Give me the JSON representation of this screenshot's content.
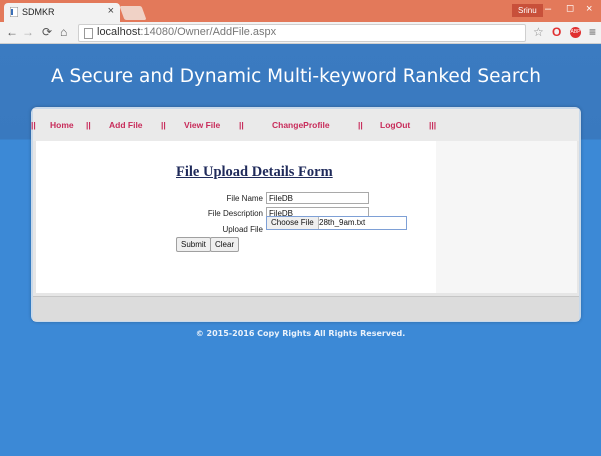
{
  "browser": {
    "tab_title": "SDMKR",
    "tab_close": "×",
    "user_badge": "Srinu",
    "window_min": "–",
    "window_max": "◻",
    "window_close": "×",
    "url_host": "localhost",
    "url_rest": ":14080/Owner/AddFile.aspx",
    "icons": {
      "back": "back-arrow-icon",
      "forward": "forward-arrow-icon",
      "reload": "reload-icon",
      "home": "home-icon",
      "bookmark": "star-icon",
      "opera": "opera-icon",
      "adblock": "adblock-icon",
      "menu": "menu-icon"
    }
  },
  "site": {
    "title": "A Secure and Dynamic Multi-keyword Ranked Search",
    "copyright": "© 2015-2016 Copy Rights All Rights Reserved."
  },
  "menu": {
    "separator_lead": "||",
    "home": "Home",
    "sep1": "||",
    "add_file": "Add File",
    "sep2": "||",
    "view_file": "View File",
    "sep3": "||",
    "change_profile": "ChangeProfile",
    "sep4": "||",
    "logout": "LogOut",
    "sep5": "|||"
  },
  "form": {
    "title": "File Upload Details Form",
    "file_name_label": "File Name",
    "file_name_value": "FileDB",
    "file_description_label": "File Description",
    "file_description_value": "FileDB",
    "upload_file_label": "Upload File",
    "choose_file_button": "Choose File",
    "chosen_file_name": "28th_9am.txt",
    "submit_button": "Submit",
    "clear_button": "Clear"
  },
  "colors": {
    "titlebar": "#e3795a",
    "page_background": "#3a84cc",
    "menu_link": "#c82b5a",
    "form_title": "#1f2a5a"
  }
}
